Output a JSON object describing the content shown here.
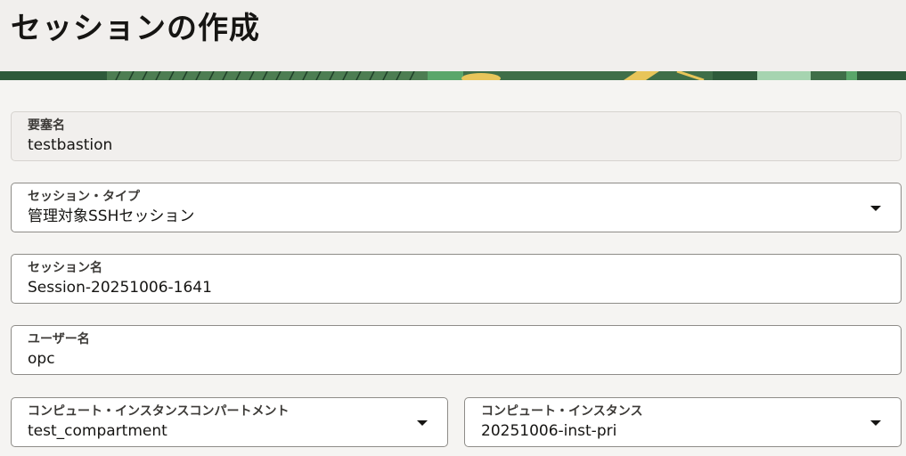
{
  "page": {
    "title": "セッションの作成"
  },
  "fields": {
    "bastion": {
      "label": "要塞名",
      "value": "testbastion"
    },
    "session_type": {
      "label": "セッション・タイプ",
      "value": "管理対象SSHセッション"
    },
    "session_name": {
      "label": "セッション名",
      "value": "Session-20251006-1641"
    },
    "username": {
      "label": "ユーザー名",
      "value": "opc"
    },
    "compartment": {
      "label": "コンピュート・インスタンスコンパートメント",
      "value": "test_compartment"
    },
    "instance": {
      "label": "コンピュート・インスタンス",
      "value": "20251006-inst-pri"
    }
  },
  "icons": {
    "dropdown": "chevron-down-icon"
  },
  "colors": {
    "header_bg": "#f1efed",
    "banner_dark": "#2e5a3a",
    "banner_green": "#5aa66a",
    "banner_yellow": "#e8c55a",
    "field_border": "#8e8c88",
    "readonly_bg": "#f1efed"
  }
}
